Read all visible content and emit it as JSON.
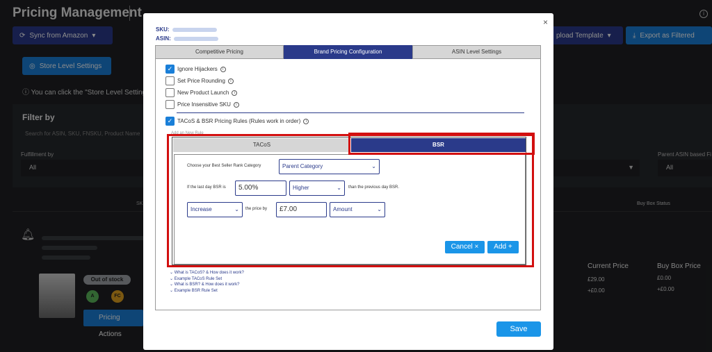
{
  "background": {
    "title": "Pricing Management",
    "sync_label": "Sync from Amazon",
    "upload_label": "pload Template",
    "export_label": "Export as Filtered",
    "store_settings_label": "Store Level Settings",
    "note": "You can click the \"Store Level Setting",
    "filter_title": "Filter by",
    "search_placeholder": "Search for ASIN, SKU, FNSKU, Product Name",
    "fulfillment_label": "Fulfillment by",
    "fulfillment_value": "All",
    "parent_asin_label": "Parent ASIN based Fi",
    "parent_asin_value": "All",
    "col_sk": "SK",
    "col_buybox_status": "Buy Box Status",
    "out_of_stock": "Out of stock",
    "badge_a": "A",
    "badge_fc": "FC",
    "pricing_actions": "Pricing Actions",
    "current_price_label": "Current Price",
    "current_price": "£29.00",
    "current_price_shipping": "+£0.00",
    "buybox_price_label": "Buy Box Price",
    "buybox_price": "£0.00",
    "buybox_shipping": "+£0.00"
  },
  "modal": {
    "sku_label": "SKU:",
    "asin_label": "ASIN:",
    "tabs": [
      {
        "label": "Competitive Pricing",
        "active": false
      },
      {
        "label": "Brand Pricing Configuration",
        "active": true
      },
      {
        "label": "ASIN Level Settings",
        "active": false
      }
    ],
    "checkboxes": [
      {
        "label": "Ignore Hijackers",
        "checked": true
      },
      {
        "label": "Set Price Rounding",
        "checked": false
      },
      {
        "label": "New Product Launch",
        "checked": false
      },
      {
        "label": "Price Insensitive SKU",
        "checked": false
      }
    ],
    "rules_checkbox": {
      "label": "TACoS & BSR Pricing Rules  (Rules work in order)",
      "checked": true
    },
    "add_new_rule": "Add an New Rule",
    "rule_tabs": {
      "tacos": "TACoS",
      "bsr": "BSR"
    },
    "bsr": {
      "category_label": "Choose your Best Seller Rank Category",
      "category_value": "Parent Category",
      "if_label": "If the last day BSR is",
      "percent_value": "5.00%",
      "direction_value": "Higher",
      "than_label": "than the previous day BSR.",
      "action_value": "Increase",
      "price_by_label": "the price by",
      "amount_value": "£7.00",
      "unit_value": "Amount",
      "cancel_label": "Cancel ×",
      "add_label": "Add +"
    },
    "help_links": [
      "What is TACoS? & How does it work?",
      "Example TACoS Rule Set",
      "What is BSR? & How does it work?",
      "Example BSR Rule Set"
    ],
    "save_label": "Save",
    "close_glyph": "×"
  },
  "colors": {
    "navy": "#2a3a8a",
    "blue": "#1a95e8",
    "highlight": "#d20f0f"
  }
}
